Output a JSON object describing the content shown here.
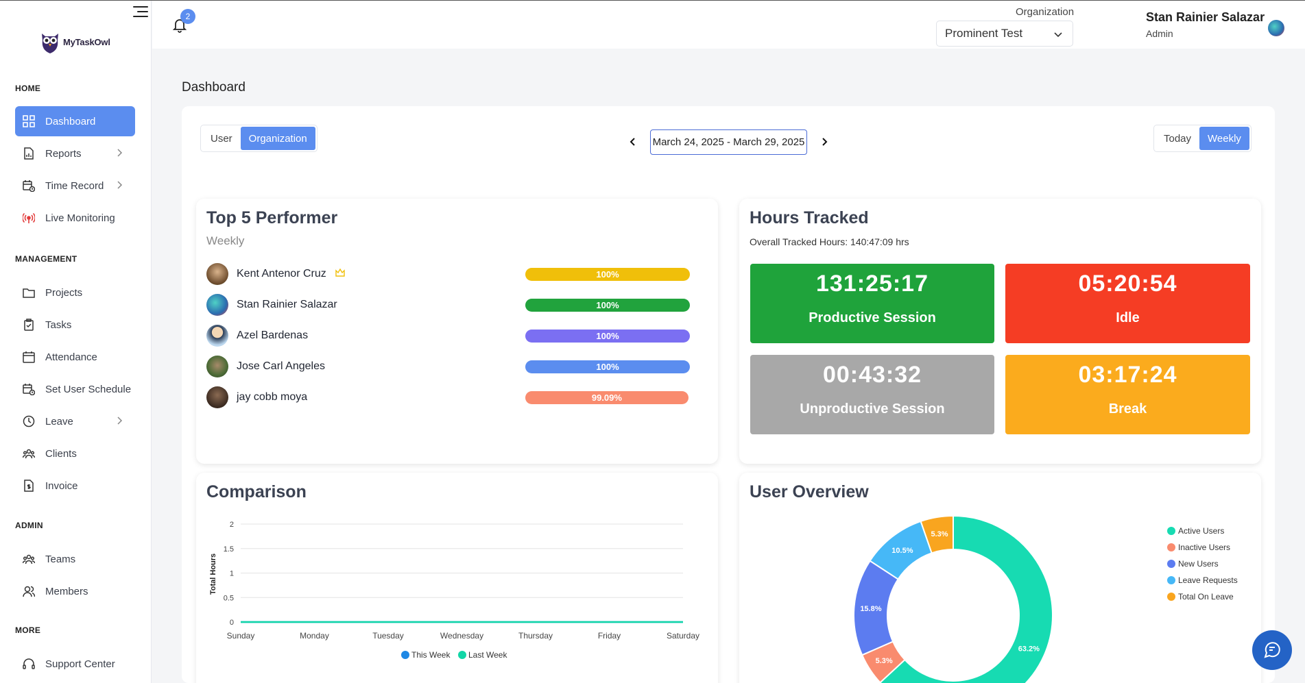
{
  "brand": "MyTaskOwl",
  "sidebar": {
    "sections": [
      "HOME",
      "MANAGEMENT",
      "ADMIN",
      "MORE"
    ],
    "items": [
      {
        "label": "Dashboard",
        "icon": "dashboard-icon",
        "active": true
      },
      {
        "label": "Reports",
        "icon": "reports-icon",
        "expandable": true
      },
      {
        "label": "Time Record",
        "icon": "time-record-icon",
        "expandable": true
      },
      {
        "label": "Live Monitoring",
        "icon": "live-monitoring-icon"
      },
      {
        "label": "Projects",
        "icon": "folder-icon"
      },
      {
        "label": "Tasks",
        "icon": "clipboard-icon"
      },
      {
        "label": "Attendance",
        "icon": "calendar-icon"
      },
      {
        "label": "Set User Schedule",
        "icon": "schedule-icon"
      },
      {
        "label": "Leave",
        "icon": "clock-icon",
        "expandable": true
      },
      {
        "label": "Clients",
        "icon": "clients-icon"
      },
      {
        "label": "Invoice",
        "icon": "invoice-icon"
      },
      {
        "label": "Teams",
        "icon": "teams-icon"
      },
      {
        "label": "Members",
        "icon": "members-icon"
      },
      {
        "label": "Support Center",
        "icon": "headset-icon"
      }
    ]
  },
  "header": {
    "notification_count": "2",
    "org_label": "Organization",
    "org_value": "Prominent Test",
    "user_name": "Stan Rainier Salazar",
    "user_role": "Admin"
  },
  "page_title": "Dashboard",
  "filters": {
    "scope_options": [
      "User",
      "Organization"
    ],
    "scope_selected": "Organization",
    "date_range": "March 24, 2025 - March 29, 2025",
    "period_options": [
      "Today",
      "Weekly"
    ],
    "period_selected": "Weekly"
  },
  "performers": {
    "title": "Top 5 Performer",
    "subtitle": "Weekly",
    "items": [
      {
        "name": "Kent Antenor Cruz",
        "percent": "100%",
        "fraction": 1.0,
        "color": "#f0bf0a",
        "crown": true
      },
      {
        "name": "Stan Rainier Salazar",
        "percent": "100%",
        "fraction": 1.0,
        "color": "#21a33d"
      },
      {
        "name": "Azel Bardenas",
        "percent": "100%",
        "fraction": 1.0,
        "color": "#7b6ff2"
      },
      {
        "name": "Jose Carl Angeles",
        "percent": "100%",
        "fraction": 1.0,
        "color": "#5b8def"
      },
      {
        "name": "jay cobb moya",
        "percent": "99.09%",
        "fraction": 0.9909,
        "color": "#f98b6e"
      }
    ]
  },
  "hours": {
    "title": "Hours Tracked",
    "overall": "Overall Tracked Hours: 140:47:09 hrs",
    "tiles": [
      {
        "value": "131:25:17",
        "label": "Productive Session",
        "color": "#1fa33b"
      },
      {
        "value": "05:20:54",
        "label": "Idle",
        "color": "#f53d24"
      },
      {
        "value": "00:43:32",
        "label": "Unproductive Session",
        "color": "#a8a8a8"
      },
      {
        "value": "03:17:24",
        "label": "Break",
        "color": "#fbab1d"
      }
    ]
  },
  "comparison": {
    "title": "Comparison",
    "chart_data": {
      "type": "line",
      "categories": [
        "Sunday",
        "Monday",
        "Tuesday",
        "Wednesday",
        "Thursday",
        "Friday",
        "Saturday"
      ],
      "ylabel": "Total Hours",
      "yticks": [
        "0",
        "0.5",
        "1",
        "1.5",
        "2"
      ],
      "ylim": [
        0,
        2
      ],
      "grid": true,
      "legend_position": "bottom",
      "series": [
        {
          "name": "This Week",
          "values": [
            0,
            0,
            0,
            0,
            0,
            0,
            0
          ],
          "color": "#1e88e5"
        },
        {
          "name": "Last Week",
          "values": [
            0,
            0,
            0,
            0,
            0,
            0,
            0
          ],
          "color": "#12d6a7"
        }
      ]
    }
  },
  "overview": {
    "title": "User Overview",
    "chart_data": {
      "type": "pie",
      "donut": true,
      "labels": [
        "Active Users",
        "Inactive Users",
        "New Users",
        "Leave Requests",
        "Total On Leave"
      ],
      "values": [
        63.2,
        5.3,
        15.8,
        10.5,
        5.3
      ],
      "value_labels": [
        "63.2%",
        "5.3%",
        "15.8%",
        "10.5%",
        "5.3%"
      ],
      "colors": [
        "#17dbb2",
        "#f98b6e",
        "#5c7cf0",
        "#46b8f7",
        "#f9a51f"
      ],
      "legend_position": "right"
    }
  }
}
